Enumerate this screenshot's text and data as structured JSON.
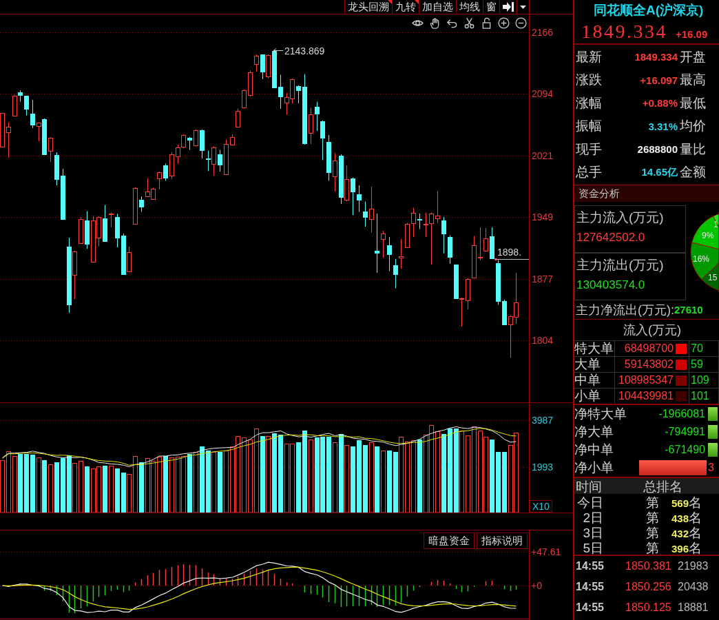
{
  "toolbar": {
    "buttons": [
      {
        "label": "龙头回溯",
        "flagged": true
      },
      {
        "label": "九转",
        "flagged": true
      },
      {
        "label": "加自选",
        "flagged": false
      },
      {
        "label": "均线",
        "flagged": false
      },
      {
        "label": "窗",
        "flagged": false
      }
    ]
  },
  "price_chart": {
    "axis_labels": [
      "2166",
      "2094",
      "2021",
      "1949",
      "1877",
      "1804"
    ],
    "high_label": "2143.869",
    "last_label": "1898."
  },
  "volume_chart": {
    "axis_labels": [
      "3987",
      "1993"
    ],
    "unit": "X10"
  },
  "indicator_chart": {
    "buttons": [
      "暗盘资金",
      "指标说明"
    ],
    "axis_labels": [
      "+47.61",
      "+0"
    ]
  },
  "quote": {
    "title": "同花顺全A(沪深京)",
    "price": "1849.334",
    "change": "+16.09",
    "rows": [
      {
        "label": "最新",
        "value": "1849.334",
        "color": "#ff3c3c",
        "label_2": "开盘"
      },
      {
        "label": "涨跌",
        "value": "+16.097",
        "color": "#ff3c3c",
        "label_2": "最高"
      },
      {
        "label": "涨幅",
        "value": "+0.88%",
        "color": "#ff3c3c",
        "label_2": "最低"
      },
      {
        "label": "振幅",
        "value": "3.31%",
        "color": "#2ad4ec",
        "label_2": "均价"
      },
      {
        "label": "现手",
        "value": "2688800",
        "color": "#f0f0f0",
        "label_2": "量比"
      },
      {
        "label": "总手",
        "value": "14.65亿",
        "color": "#2ad4ec",
        "label_2": "金额"
      }
    ]
  },
  "fund_analysis": {
    "title": "资金分析",
    "cards": [
      {
        "label": "主力流入(万元)",
        "value": "127642502.0",
        "color": "#ff3c3c"
      },
      {
        "label": "主力流出(万元)",
        "value": "130403574.0",
        "color": "#1ee01e"
      }
    ],
    "pie": [
      {
        "label": "1",
        "color": "#1ee61e"
      },
      {
        "label": "9%",
        "color": "#00c400"
      },
      {
        "label": "16%",
        "color": "#009a00"
      },
      {
        "label": "15",
        "color": "#006400"
      }
    ],
    "net_label": "主力净流出(万元):",
    "net_value": "27610"
  },
  "flow_table": {
    "columns": [
      "流入(万元)"
    ],
    "rows": [
      {
        "label": "特大单",
        "inflow": "68498700",
        "color": "#ff0000",
        "column_2": "70"
      },
      {
        "label": "大单",
        "inflow": "59143802",
        "color": "#d00000",
        "column_2": "59"
      },
      {
        "label": "中单",
        "inflow": "108985347",
        "color": "#800000",
        "column_2": "109"
      },
      {
        "label": "小单",
        "inflow": "104439981",
        "color": "#400000",
        "column_2": "101"
      }
    ]
  },
  "net_flows": [
    {
      "label": "净特大单",
      "kind": "outflow",
      "value": "-1966081"
    },
    {
      "label": "净大单",
      "kind": "outflow",
      "value": "-794991"
    },
    {
      "label": "净中单",
      "kind": "outflow",
      "value": "-671490"
    },
    {
      "label": "净小单",
      "kind": "inflow",
      "value": "3"
    }
  ],
  "ranking": {
    "columns": [
      "时间",
      "总排名"
    ],
    "rows": [
      {
        "period": "今日",
        "prefix": "第",
        "rank": "569",
        "suffix": "名"
      },
      {
        "period": "2日",
        "prefix": "第",
        "rank": "438",
        "suffix": "名"
      },
      {
        "period": "3日",
        "prefix": "第",
        "rank": "432",
        "suffix": "名"
      },
      {
        "period": "5日",
        "prefix": "第",
        "rank": "396",
        "suffix": "名"
      }
    ]
  },
  "ticks": [
    {
      "time": "14:55",
      "price": "1850.381",
      "volume": "21983"
    },
    {
      "time": "14:55",
      "price": "1850.256",
      "volume": "20438"
    },
    {
      "time": "14:55",
      "price": "1850.125",
      "volume": "18881"
    }
  ]
}
